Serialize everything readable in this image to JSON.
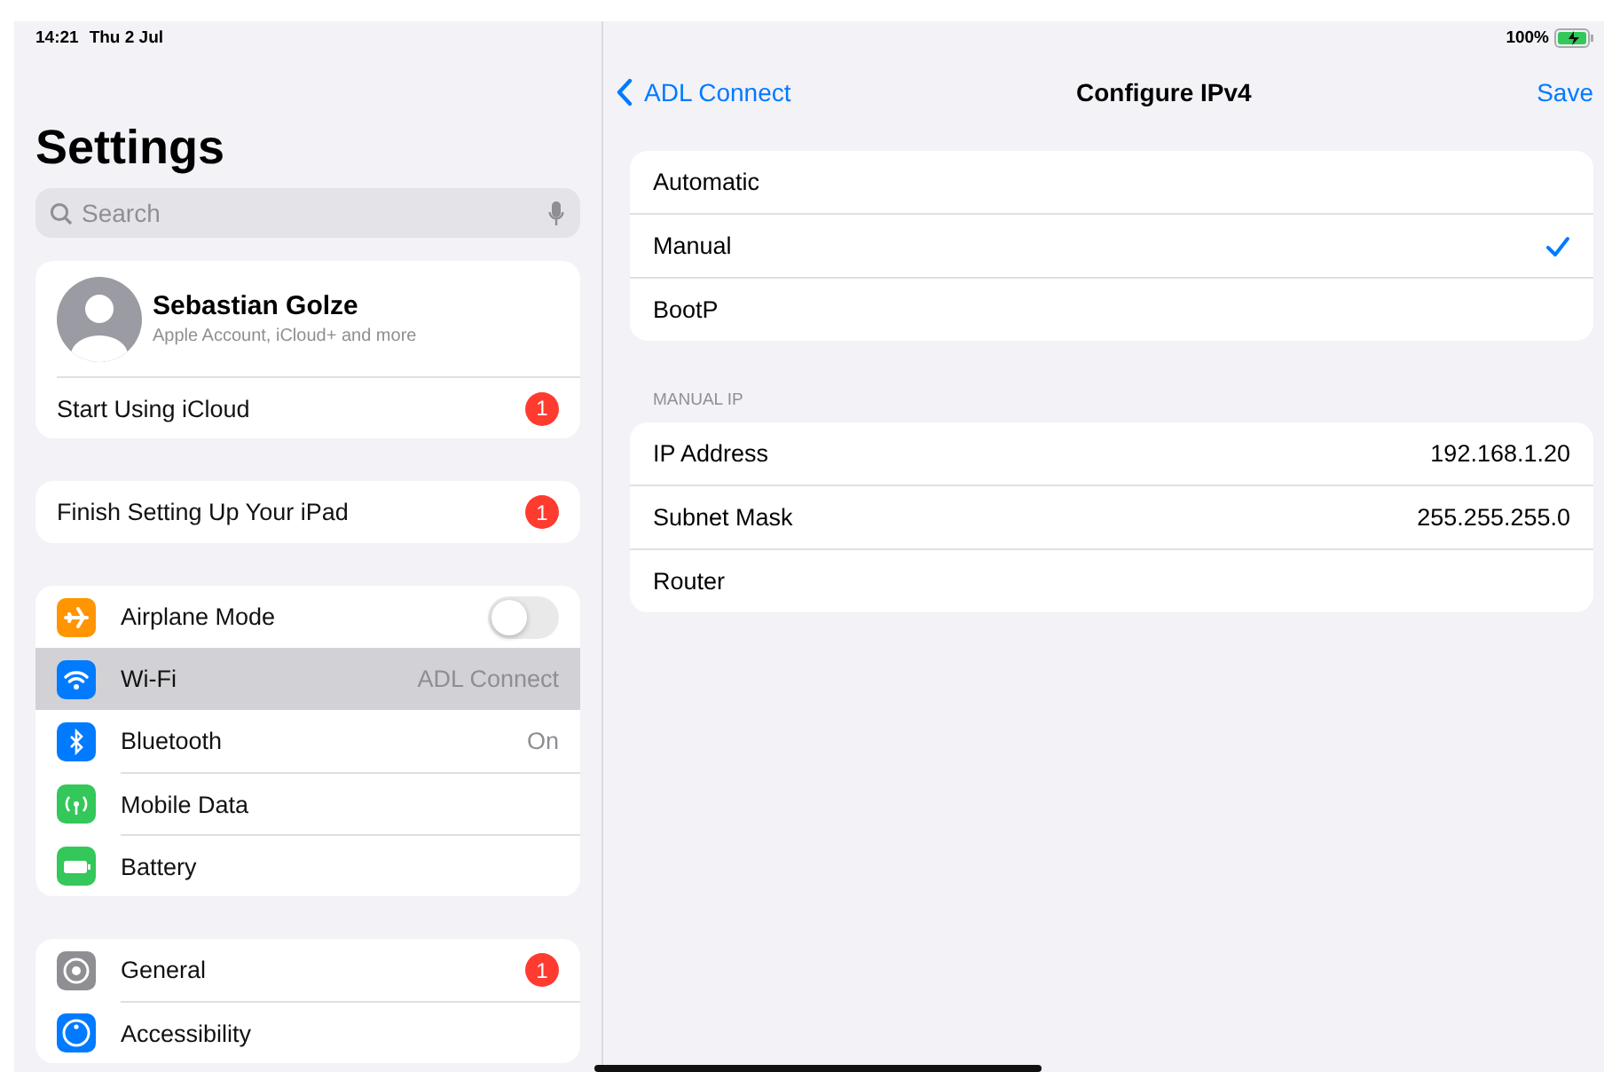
{
  "status_bar": {
    "time": "14:21",
    "date": "Thu 2 Jul",
    "battery": "100%",
    "charging": true
  },
  "sidebar": {
    "title": "Settings",
    "search": {
      "placeholder": "Search"
    },
    "profile": {
      "name": "Sebastian Golze",
      "subtitle": "Apple Account, iCloud+ and more"
    },
    "groups": [
      {
        "items": [
          {
            "kind": "plain",
            "label": "Start Using iCloud",
            "badge": "1",
            "selected": false
          }
        ]
      },
      {
        "items": [
          {
            "kind": "plain",
            "label": "Finish Setting Up Your iPad",
            "badge": "1",
            "selected": false
          }
        ]
      },
      {
        "items": [
          {
            "kind": "toggle",
            "color": "#ff9500",
            "label": "Airplane Mode",
            "on": false,
            "selected": false
          },
          {
            "kind": "value",
            "color": "#007aff",
            "label": "Wi-Fi",
            "value": "ADL Connect",
            "selected": true
          },
          {
            "kind": "value",
            "color": "#007aff",
            "label": "Bluetooth",
            "value": "On",
            "selected": false
          },
          {
            "kind": "value",
            "color": "#34c759",
            "label": "Mobile Data",
            "selected": false
          },
          {
            "kind": "value",
            "color": "#34c759",
            "label": "Battery",
            "selected": false
          }
        ]
      },
      {
        "items": [
          {
            "kind": "value",
            "color": "#8e8e93",
            "label": "General",
            "badge": "1",
            "selected": false
          },
          {
            "kind": "value",
            "color": "#007aff",
            "label": "Accessibility",
            "selected": false
          }
        ]
      }
    ]
  },
  "detail": {
    "back": "ADL Connect",
    "title": "Configure IPv4",
    "action": "Save",
    "options": [
      {
        "label": "Automatic",
        "selected": false
      },
      {
        "label": "Manual",
        "selected": true
      },
      {
        "label": "BootP",
        "selected": false
      }
    ],
    "section": "MANUAL IP",
    "fields": [
      {
        "label": "IP Address",
        "value": "192.168.1.20"
      },
      {
        "label": "Subnet Mask",
        "value": "255.255.255.0"
      },
      {
        "label": "Router"
      }
    ]
  }
}
